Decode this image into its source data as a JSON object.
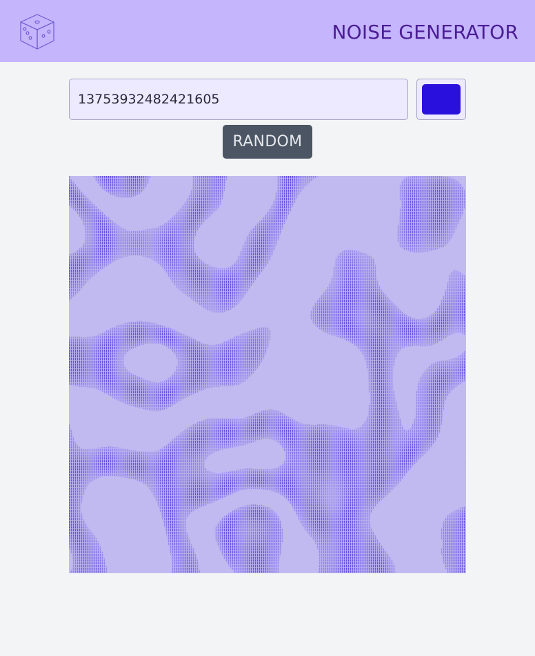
{
  "header": {
    "logo_icon": "dice-icon",
    "title": "NOISE GENERATOR"
  },
  "controls": {
    "seed_value": "13753932482421605",
    "color_value": "#2a10dc",
    "random_label": "RANDOM"
  },
  "colors": {
    "header_bg": "#c4b5fd",
    "title_text": "#4c1d95",
    "page_bg": "#f3f4f6",
    "input_bg": "#ede9fe",
    "button_bg": "#4b5563",
    "noise_light": "#c4bdf0",
    "noise_dark": "#2a10dc"
  },
  "noise": {
    "icon": "noise-texture-image"
  }
}
